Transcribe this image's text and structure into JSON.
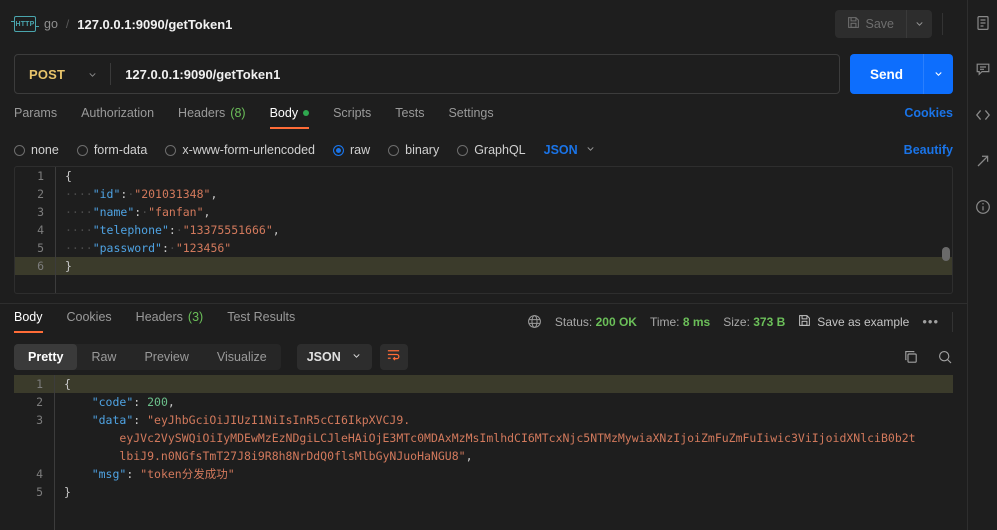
{
  "breadcrumb": {
    "protocol_badge": "HTTP",
    "collection": "go",
    "separator": "/",
    "request_name": "127.0.0.1:9090/getToken1"
  },
  "toolbar": {
    "save_label": "Save",
    "save_icon": "floppy-disk-icon",
    "save_dropdown_icon": "chevron-down-icon"
  },
  "request": {
    "method": "POST",
    "method_dropdown_icon": "chevron-down-icon",
    "url": "127.0.0.1:9090/getToken1",
    "send_label": "Send",
    "send_dropdown_icon": "chevron-down-icon"
  },
  "request_tabs": {
    "items": [
      {
        "label": "Params",
        "count": "",
        "active": false,
        "dot": false
      },
      {
        "label": "Authorization",
        "count": "",
        "active": false,
        "dot": false
      },
      {
        "label": "Headers",
        "count": "(8)",
        "active": false,
        "dot": false
      },
      {
        "label": "Body",
        "count": "",
        "active": true,
        "dot": true
      },
      {
        "label": "Scripts",
        "count": "",
        "active": false,
        "dot": false
      },
      {
        "label": "Tests",
        "count": "",
        "active": false,
        "dot": false
      },
      {
        "label": "Settings",
        "count": "",
        "active": false,
        "dot": false
      }
    ],
    "cookies_link": "Cookies"
  },
  "body_type": {
    "options": [
      {
        "label": "none",
        "selected": false
      },
      {
        "label": "form-data",
        "selected": false
      },
      {
        "label": "x-www-form-urlencoded",
        "selected": false
      },
      {
        "label": "raw",
        "selected": true
      },
      {
        "label": "binary",
        "selected": false
      },
      {
        "label": "GraphQL",
        "selected": false
      }
    ],
    "format": "JSON",
    "format_dropdown_icon": "chevron-down-icon",
    "beautify_label": "Beautify"
  },
  "request_body": {
    "lines": [
      {
        "no": "1",
        "highlight": false,
        "tokens": [
          {
            "t": "{",
            "c": "p"
          }
        ]
      },
      {
        "no": "2",
        "highlight": false,
        "tokens": [
          {
            "t": "····",
            "c": "ws"
          },
          {
            "t": "\"id\"",
            "c": "k"
          },
          {
            "t": ":",
            "c": "p"
          },
          {
            "t": "·",
            "c": "ws"
          },
          {
            "t": "\"201031348\"",
            "c": "s"
          },
          {
            "t": ",",
            "c": "p"
          }
        ]
      },
      {
        "no": "3",
        "highlight": false,
        "tokens": [
          {
            "t": "····",
            "c": "ws"
          },
          {
            "t": "\"name\"",
            "c": "k"
          },
          {
            "t": ":",
            "c": "p"
          },
          {
            "t": "·",
            "c": "ws"
          },
          {
            "t": "\"fanfan\"",
            "c": "s"
          },
          {
            "t": ",",
            "c": "p"
          }
        ]
      },
      {
        "no": "4",
        "highlight": false,
        "tokens": [
          {
            "t": "····",
            "c": "ws"
          },
          {
            "t": "\"telephone\"",
            "c": "k"
          },
          {
            "t": ":",
            "c": "p"
          },
          {
            "t": "·",
            "c": "ws"
          },
          {
            "t": "\"13375551666\"",
            "c": "s"
          },
          {
            "t": ",",
            "c": "p"
          }
        ]
      },
      {
        "no": "5",
        "highlight": false,
        "tokens": [
          {
            "t": "····",
            "c": "ws"
          },
          {
            "t": "\"password\"",
            "c": "k"
          },
          {
            "t": ":",
            "c": "p"
          },
          {
            "t": "·",
            "c": "ws"
          },
          {
            "t": "\"123456\"",
            "c": "s"
          }
        ]
      },
      {
        "no": "6",
        "highlight": true,
        "tokens": [
          {
            "t": "}",
            "c": "p"
          }
        ]
      }
    ]
  },
  "response_tabs": {
    "items": [
      {
        "label": "Body",
        "count": "",
        "active": true
      },
      {
        "label": "Cookies",
        "count": "",
        "active": false
      },
      {
        "label": "Headers",
        "count": "(3)",
        "active": false
      },
      {
        "label": "Test Results",
        "count": "",
        "active": false
      }
    ]
  },
  "response_meta": {
    "globe_icon": "globe-icon",
    "status_label": "Status:",
    "status_value": "200 OK",
    "time_label": "Time:",
    "time_value": "8 ms",
    "size_label": "Size:",
    "size_value": "373 B",
    "save_example_label": "Save as example",
    "save_example_icon": "floppy-disk-icon",
    "more_icon": "ellipsis-icon"
  },
  "response_view": {
    "segments": [
      {
        "label": "Pretty",
        "active": true
      },
      {
        "label": "Raw",
        "active": false
      },
      {
        "label": "Preview",
        "active": false
      },
      {
        "label": "Visualize",
        "active": false
      }
    ],
    "format": "JSON",
    "format_dropdown_icon": "chevron-down-icon",
    "wrap_icon": "word-wrap-icon",
    "copy_icon": "copy-icon",
    "search_icon": "search-icon"
  },
  "response_body": {
    "lines": [
      {
        "no": "1",
        "highlight": true,
        "tokens": [
          {
            "t": "{",
            "c": "p"
          }
        ]
      },
      {
        "no": "2",
        "highlight": false,
        "tokens": [
          {
            "t": "    ",
            "c": "ws"
          },
          {
            "t": "\"code\"",
            "c": "k"
          },
          {
            "t": ": ",
            "c": "p"
          },
          {
            "t": "200",
            "c": "n"
          },
          {
            "t": ",",
            "c": "p"
          }
        ]
      },
      {
        "no": "3",
        "highlight": false,
        "tokens": [
          {
            "t": "    ",
            "c": "ws"
          },
          {
            "t": "\"data\"",
            "c": "k"
          },
          {
            "t": ": ",
            "c": "p"
          },
          {
            "t": "\"eyJhbGciOiJIUzI1NiIsInR5cCI6IkpXVCJ9.",
            "c": "s"
          }
        ]
      },
      {
        "no": "",
        "highlight": false,
        "tokens": [
          {
            "t": "        ",
            "c": "ws"
          },
          {
            "t": "eyJVc2VySWQiOiIyMDEwMzEzNDgiLCJleHAiOjE3MTc0MDAxMzMsImlhdCI6MTcxNjc5NTMzMywiaXNzIjoiZmFuZmFuIiwic3ViIjoidXNlciB0b2t",
            "c": "s"
          }
        ]
      },
      {
        "no": "",
        "highlight": false,
        "tokens": [
          {
            "t": "        ",
            "c": "ws"
          },
          {
            "t": "lbiJ9.n0NGfsTmT27J8i9R8h8NrDdQ0flsMlbGyNJuoHaNGU8\"",
            "c": "s"
          },
          {
            "t": ",",
            "c": "p"
          }
        ]
      },
      {
        "no": "4",
        "highlight": false,
        "tokens": [
          {
            "t": "    ",
            "c": "ws"
          },
          {
            "t": "\"msg\"",
            "c": "k"
          },
          {
            "t": ": ",
            "c": "p"
          },
          {
            "t": "\"token分发成功\"",
            "c": "s"
          }
        ]
      },
      {
        "no": "5",
        "highlight": false,
        "tokens": [
          {
            "t": "}",
            "c": "p"
          }
        ]
      }
    ]
  },
  "right_rail": {
    "icons": [
      {
        "name": "documentation-icon"
      },
      {
        "name": "comment-icon"
      },
      {
        "name": "code-snippet-icon"
      },
      {
        "name": "share-icon"
      },
      {
        "name": "info-icon"
      }
    ]
  }
}
